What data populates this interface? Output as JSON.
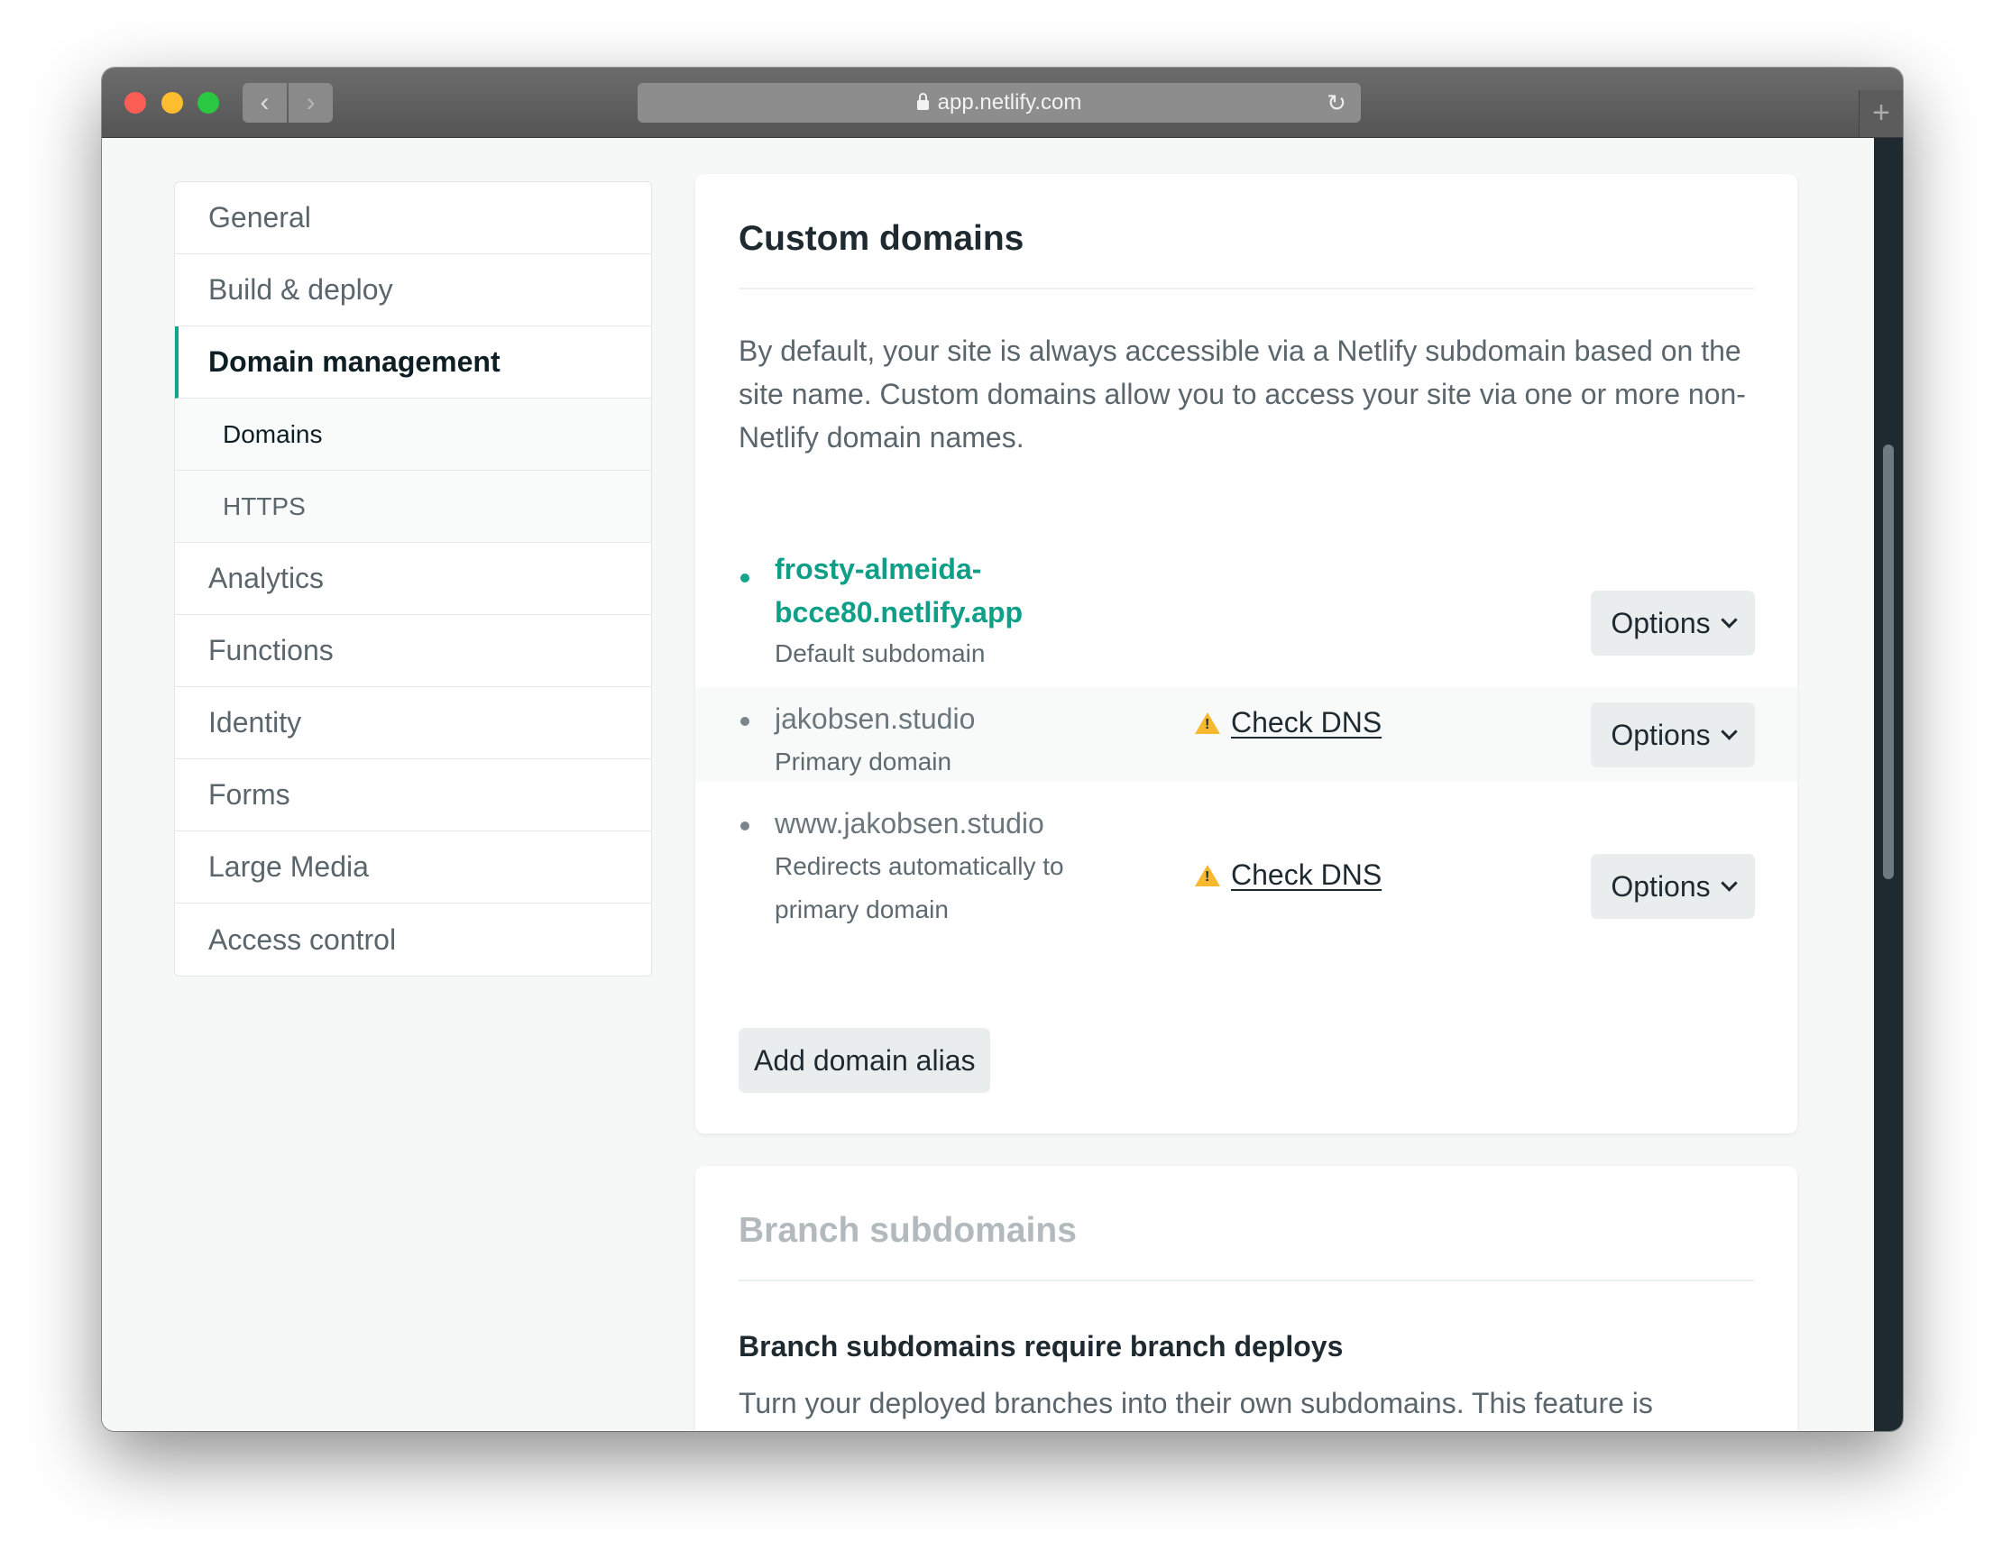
{
  "browser": {
    "url": "app.netlify.com",
    "back_glyph": "‹",
    "forward_glyph": "›",
    "reload_glyph": "↻",
    "newtab_glyph": "+"
  },
  "sidebar": {
    "items": [
      {
        "label": "General"
      },
      {
        "label": "Build & deploy"
      },
      {
        "label": "Domain management"
      },
      {
        "label": "Domains"
      },
      {
        "label": "HTTPS"
      },
      {
        "label": "Analytics"
      },
      {
        "label": "Functions"
      },
      {
        "label": "Identity"
      },
      {
        "label": "Forms"
      },
      {
        "label": "Large Media"
      },
      {
        "label": "Access control"
      }
    ]
  },
  "custom_domains": {
    "title": "Custom domains",
    "intro": "By default, your site is always accessible via a Netlify subdomain based on the site name. Custom domains allow you to access your site via one or more non-Netlify domain names.",
    "domains": [
      {
        "name_line1": "frosty-almeida-",
        "name_line2": "bcce80.netlify.app",
        "sub": "Default subdomain",
        "options": "Options"
      },
      {
        "name": "jakobsen.studio",
        "sub": "Primary domain",
        "dns": "Check DNS",
        "options": "Options"
      },
      {
        "name": "www.jakobsen.studio",
        "sub_line1": "Redirects automatically to",
        "sub_line2": "primary domain",
        "dns": "Check DNS",
        "options": "Options"
      }
    ],
    "add_alias": "Add domain alias"
  },
  "branch_subdomains": {
    "title": "Branch subdomains",
    "subtitle": "Branch subdomains require branch deploys",
    "text": "Turn your deployed branches into their own subdomains. This feature is"
  },
  "colors": {
    "accent": "#14a38b",
    "warning": "#f5b82e"
  }
}
